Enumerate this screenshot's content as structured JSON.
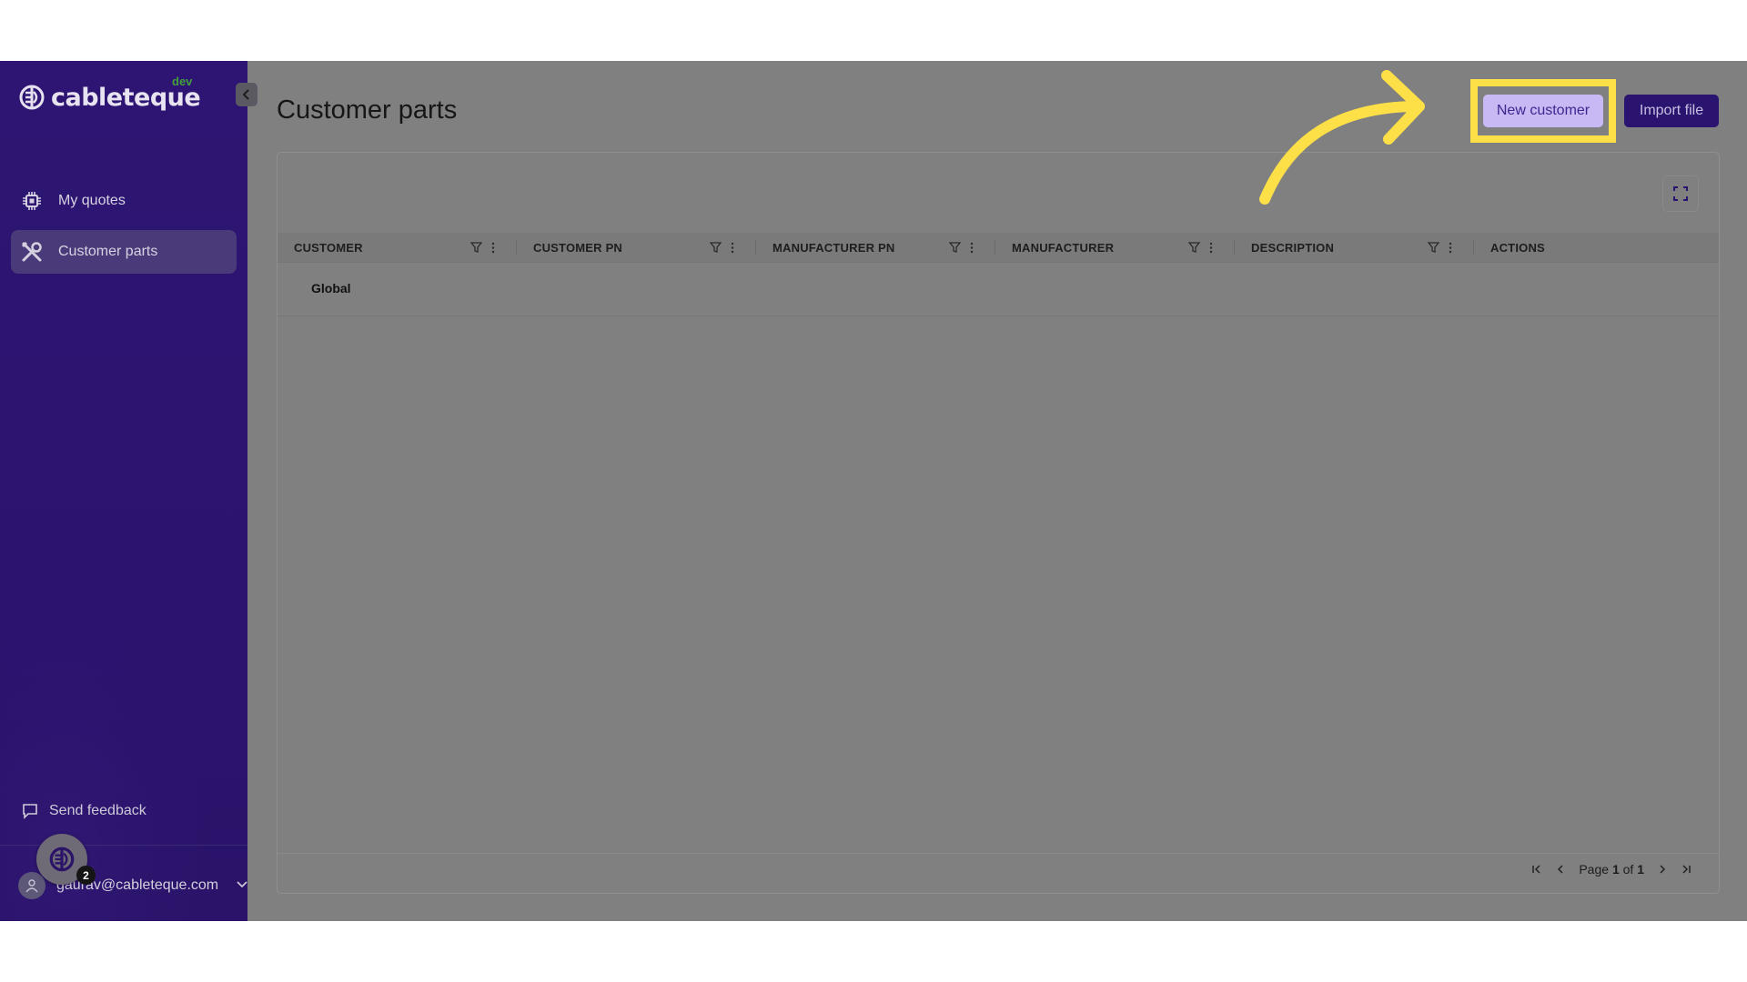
{
  "app": {
    "logo_text": "cableteque",
    "env_badge": "dev"
  },
  "sidebar": {
    "items": [
      {
        "label": "My quotes",
        "icon": "chip-icon",
        "active": false
      },
      {
        "label": "Customer parts",
        "icon": "tools-icon",
        "active": true
      }
    ],
    "feedback_label": "Send feedback",
    "user_email": "gaurav@cableteque.com",
    "chat_badge_count": "2"
  },
  "header": {
    "title": "Customer parts",
    "new_customer_label": "New customer",
    "import_file_label": "Import file"
  },
  "table": {
    "columns": [
      "CUSTOMER",
      "CUSTOMER PN",
      "MANUFACTURER PN",
      "MANUFACTURER",
      "DESCRIPTION",
      "ACTIONS"
    ],
    "rows": [
      {
        "group": "Global"
      }
    ]
  },
  "pagination": {
    "page_label": "Page",
    "current": "1",
    "of_label": "of",
    "total": "1"
  },
  "colors": {
    "sidebar_bg": "#2e1573",
    "accent": "#2b1470",
    "highlight": "#fde047",
    "overlay": "#808080"
  }
}
